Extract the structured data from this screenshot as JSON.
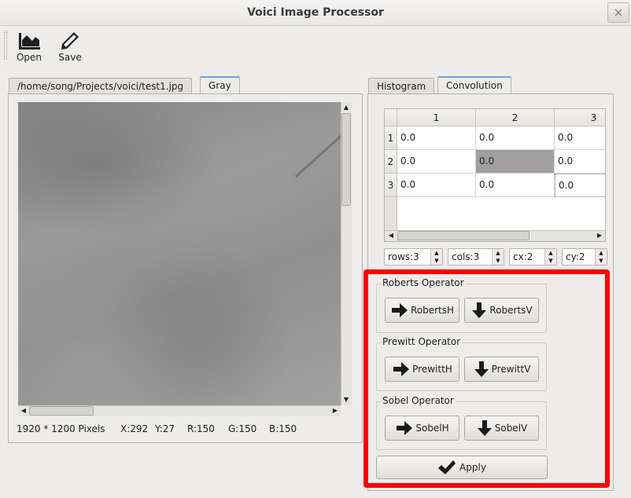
{
  "window": {
    "title": "Voici Image Processor",
    "close_glyph": "⨯"
  },
  "toolbar": {
    "open_label": "Open",
    "save_label": "Save"
  },
  "left_tabs": [
    {
      "label": "/home/song/Projects/voici/test1.jpg"
    },
    {
      "label": "Gray"
    }
  ],
  "status_bar": {
    "size": "1920 * 1200 Pixels",
    "x": "X:292",
    "y": "Y:27",
    "r": "R:150",
    "g": "G:150",
    "b": "B:150"
  },
  "right_tabs": [
    {
      "label": "Histogram"
    },
    {
      "label": "Convolution"
    }
  ],
  "kernel": {
    "column_headers": [
      "1",
      "2",
      "3"
    ],
    "row_headers": [
      "1",
      "2",
      "3"
    ],
    "cells": [
      [
        "0.0",
        "0.0",
        "0.0"
      ],
      [
        "0.0",
        "0.0",
        "0.0"
      ],
      [
        "0.0",
        "0.0",
        "0.0"
      ]
    ],
    "selected_cell_color": "#a19f9f"
  },
  "spinboxes": {
    "rows": "rows:3",
    "cols": "cols:3",
    "cx": "cx:2",
    "cy": "cy:2"
  },
  "groups": {
    "roberts": {
      "title": "Roberts Operator",
      "h_label": "RobertsH",
      "v_label": "RobertsV"
    },
    "prewitt": {
      "title": "Prewitt Operator",
      "h_label": "PrewittH",
      "v_label": "PrewittV"
    },
    "sobel": {
      "title": "Sobel Operator",
      "h_label": "SobelH",
      "v_label": "SobelV"
    }
  },
  "apply_label": "Apply",
  "colors": {
    "highlight": "#ff0000",
    "tab_accent": "#6fa3d6"
  }
}
